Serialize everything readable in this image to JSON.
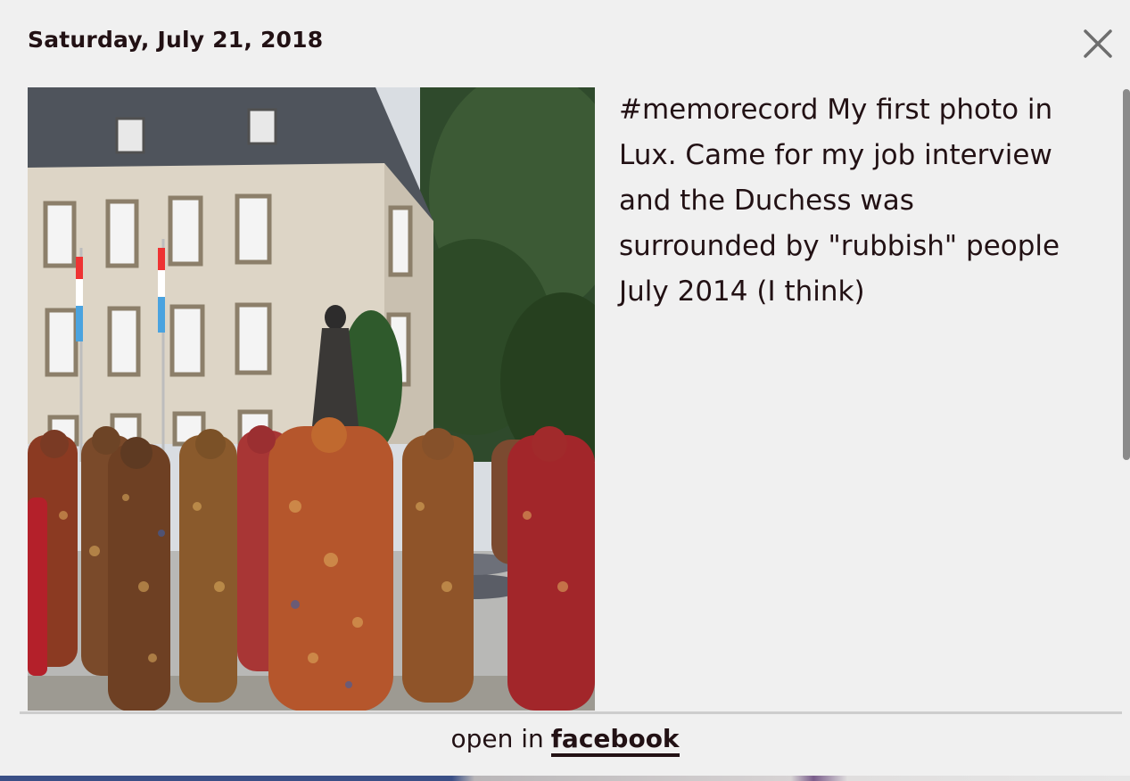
{
  "modal": {
    "date": "Saturday, July 21, 2018",
    "close_icon": "close-icon",
    "photo_alt": "Statue surrounded by colorful can-figure sculptures in front of a building",
    "caption": "#memorecord My first photo in\nLux. Came for my job interview\nand the Duchess was\nsurrounded by \"rubbish\" people\nJuly 2014 (I think)",
    "footer": {
      "prefix": "open in",
      "link_label": "facebook"
    }
  },
  "colors": {
    "background": "#f0f0f0",
    "text": "#221114",
    "divider": "#cdcdcd",
    "scrollbar": "#8a8a8a"
  }
}
